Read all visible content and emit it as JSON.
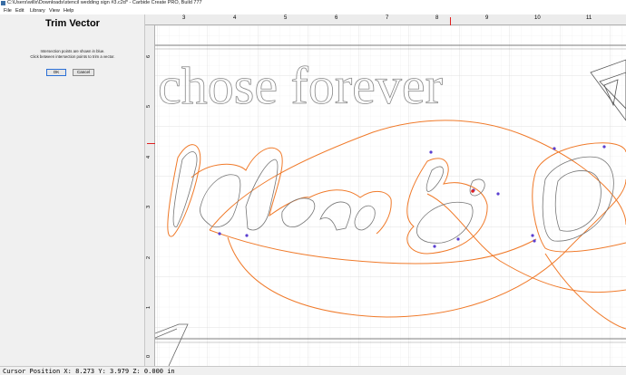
{
  "window": {
    "title": "C:\\Users\\willx\\Downloads\\stencil wedding sign #3.c2d* - Carbide Create PRO, Build 777"
  },
  "menu": [
    {
      "label": "File"
    },
    {
      "label": "Edit"
    },
    {
      "label": "Library"
    },
    {
      "label": "View"
    },
    {
      "label": "Help"
    }
  ],
  "panel": {
    "title": "Trim Vector",
    "message_line1": "Intersection points are shown in blue.",
    "message_line2": "Click between intersection points to trim a vector.",
    "ok_label": "OK",
    "cancel_label": "Cancel"
  },
  "ruler": {
    "horizontal": [
      "3",
      "4",
      "5",
      "6",
      "7",
      "8",
      "9",
      "10",
      "11"
    ],
    "vertical": [
      "6",
      "5",
      "4",
      "3",
      "2",
      "1",
      "0"
    ]
  },
  "canvas": {
    "headline_text": "chose forever",
    "names_text": "lden & D",
    "colors": {
      "vector_orange": "#f07a2a",
      "text_outline": "#888888",
      "intersection_point": "#5a3fd0",
      "cursor_marker": "#e02020",
      "grid": "#e6e6e6"
    }
  },
  "status": {
    "cursor_position": "Cursor Position X: 8.273 Y: 3.979 Z: 0.000 in"
  }
}
